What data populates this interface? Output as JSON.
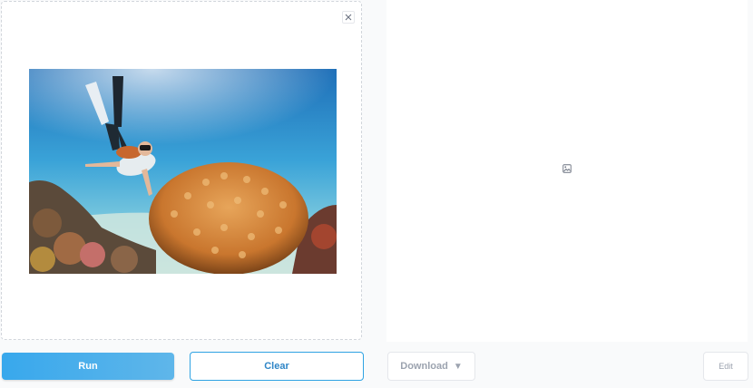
{
  "input_panel": {
    "image_alt": "freediver over coral reef"
  },
  "actions": {
    "run_label": "Run",
    "clear_label": "Clear"
  },
  "output_panel": {
    "download_label": "Download",
    "download_caret": "▼",
    "edit_label": "Edit"
  },
  "icons": {
    "close": "close-icon",
    "placeholder": "image-icon",
    "caret": "caret-down-icon"
  }
}
